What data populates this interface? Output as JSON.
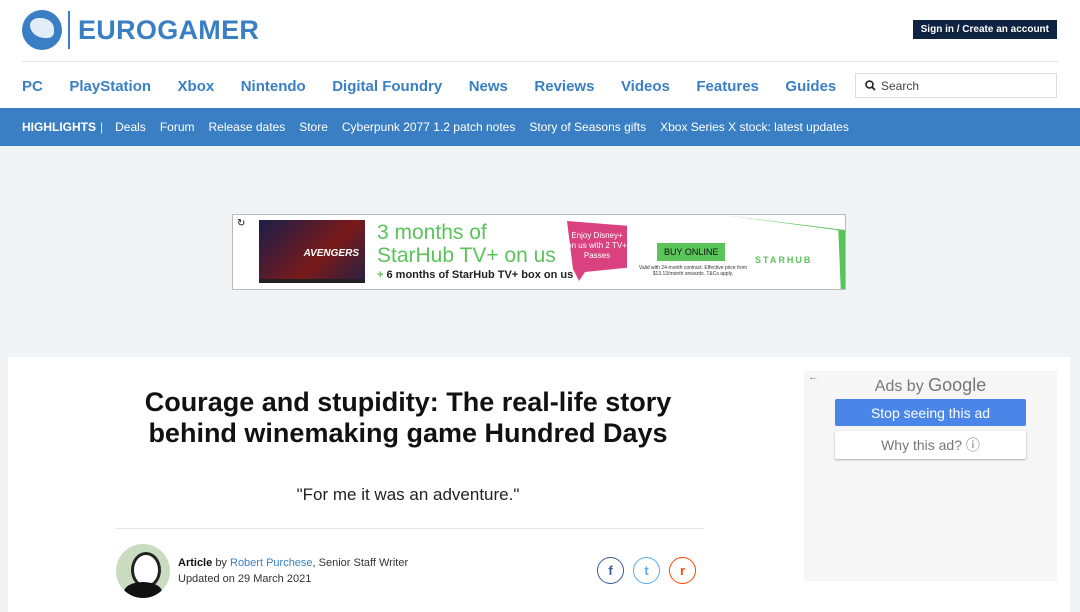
{
  "brand": {
    "name": "EUROGAMER",
    "accent": "#3a7fc4"
  },
  "header": {
    "signin": "Sign in / Create an account",
    "search_placeholder": "Search"
  },
  "nav": [
    "PC",
    "PlayStation",
    "Xbox",
    "Nintendo",
    "Digital Foundry",
    "News",
    "Reviews",
    "Videos",
    "Features",
    "Guides"
  ],
  "highlights": {
    "label": "HIGHLIGHTS",
    "sep": "|",
    "items": [
      "Deals",
      "Forum",
      "Release dates",
      "Store",
      "Cyberpunk 2077 1.2 patch notes",
      "Story of Seasons gifts",
      "Xbox Series X stock: latest updates"
    ]
  },
  "ad": {
    "tv_text": "AVENGERS",
    "headline1": "3 months of",
    "headline2": "StarHub TV+ on us",
    "plus": "+",
    "sub": "6 months of StarHub TV+ box on us",
    "bubble": "Enjoy Disney+ on us with 2 TV+ Passes",
    "buy": "BUY ONLINE",
    "fine": "Valid with 24-month contract. Effective price from $13.13/month onwards. T&Cs apply.",
    "brand": "STARHUB"
  },
  "article": {
    "title": "Courage and stupidity: The real-life story behind winemaking game Hundred Days",
    "subtitle": "\"For me it was an adventure.\"",
    "type": "Article",
    "by": "by",
    "author": "Robert Purchese",
    "role": ", Senior Staff Writer",
    "updated": "Updated on 29 March 2021"
  },
  "share": {
    "facebook": "f",
    "twitter": "t",
    "reddit": "r"
  },
  "google_ads": {
    "back": "←",
    "ads_by": "Ads by",
    "google": "Google",
    "stop": "Stop seeing this ad",
    "why": "Why this ad? ⓘ"
  }
}
